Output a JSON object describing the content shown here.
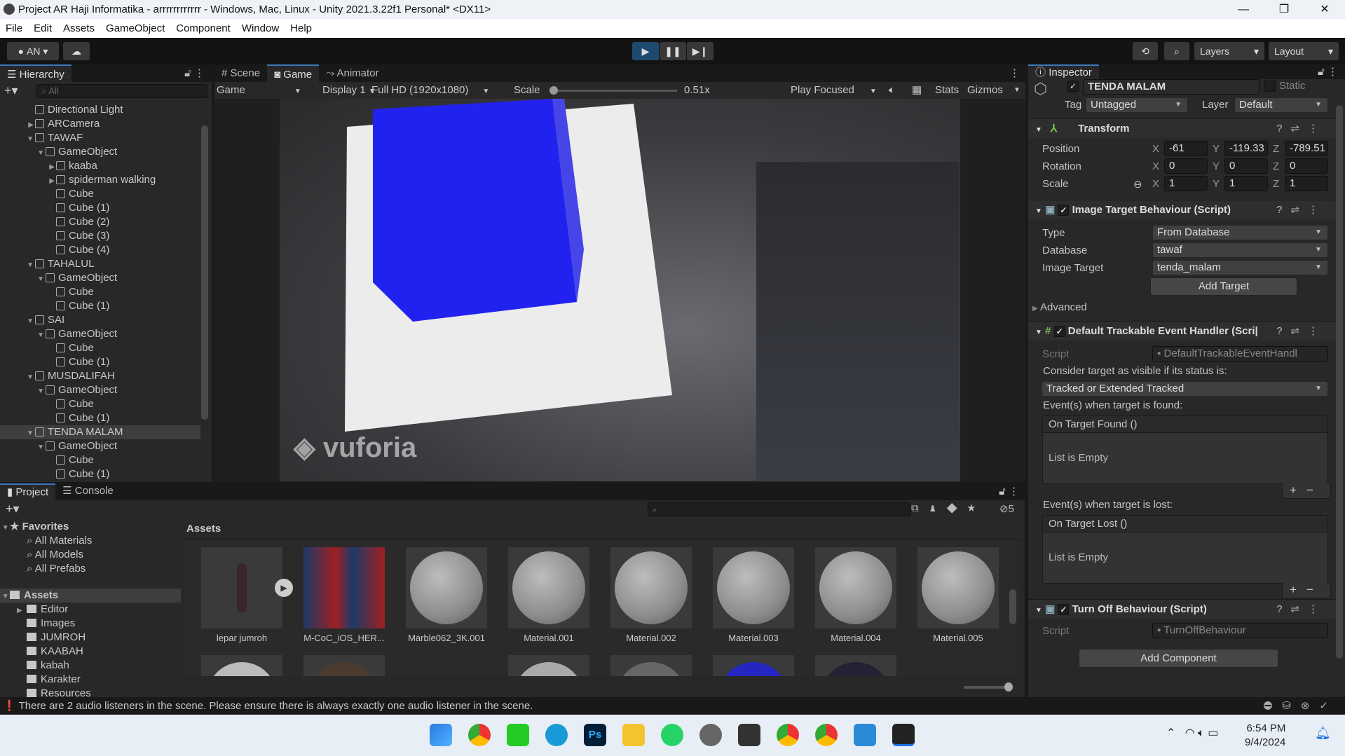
{
  "window": {
    "title": "Project AR Haji Informatika - arrrrrrrrrrrr - Windows, Mac, Linux - Unity 2021.3.22f1 Personal* <DX11>",
    "min": "—",
    "max": "❐",
    "close": "✕"
  },
  "menu": [
    "File",
    "Edit",
    "Assets",
    "GameObject",
    "Component",
    "Window",
    "Help"
  ],
  "toolbar": {
    "account": "AN",
    "layers": "Layers",
    "layout": "Layout"
  },
  "hierarchy": {
    "tab": "Hierarchy",
    "search_placeholder": "All",
    "items": [
      {
        "label": "Directional Light",
        "depth": 1,
        "arrow": ""
      },
      {
        "label": "ARCamera",
        "depth": 1,
        "arrow": "▶"
      },
      {
        "label": "TAWAF",
        "depth": 1,
        "arrow": "▼"
      },
      {
        "label": "GameObject",
        "depth": 2,
        "arrow": "▼"
      },
      {
        "label": "kaaba",
        "depth": 3,
        "arrow": "▶"
      },
      {
        "label": "spiderman walking",
        "depth": 3,
        "arrow": "▶"
      },
      {
        "label": "Cube",
        "depth": 3,
        "arrow": ""
      },
      {
        "label": "Cube (1)",
        "depth": 3,
        "arrow": ""
      },
      {
        "label": "Cube (2)",
        "depth": 3,
        "arrow": ""
      },
      {
        "label": "Cube (3)",
        "depth": 3,
        "arrow": ""
      },
      {
        "label": "Cube (4)",
        "depth": 3,
        "arrow": ""
      },
      {
        "label": "TAHALUL",
        "depth": 1,
        "arrow": "▼"
      },
      {
        "label": "GameObject",
        "depth": 2,
        "arrow": "▼"
      },
      {
        "label": "Cube",
        "depth": 3,
        "arrow": ""
      },
      {
        "label": "Cube (1)",
        "depth": 3,
        "arrow": ""
      },
      {
        "label": "SAI",
        "depth": 1,
        "arrow": "▼"
      },
      {
        "label": "GameObject",
        "depth": 2,
        "arrow": "▼"
      },
      {
        "label": "Cube",
        "depth": 3,
        "arrow": ""
      },
      {
        "label": "Cube (1)",
        "depth": 3,
        "arrow": ""
      },
      {
        "label": "MUSDALIFAH",
        "depth": 1,
        "arrow": "▼"
      },
      {
        "label": "GameObject",
        "depth": 2,
        "arrow": "▼"
      },
      {
        "label": "Cube",
        "depth": 3,
        "arrow": ""
      },
      {
        "label": "Cube (1)",
        "depth": 3,
        "arrow": ""
      },
      {
        "label": "TENDA MALAM",
        "depth": 1,
        "arrow": "▼",
        "selected": true
      },
      {
        "label": "GameObject",
        "depth": 2,
        "arrow": "▼"
      },
      {
        "label": "Cube",
        "depth": 3,
        "arrow": ""
      },
      {
        "label": "Cube (1)",
        "depth": 3,
        "arrow": ""
      }
    ]
  },
  "game": {
    "tabs": [
      "Scene",
      "Game",
      "Animator"
    ],
    "mode": "Game",
    "display": "Display 1",
    "resolution": "Full HD (1920x1080)",
    "scale_label": "Scale",
    "scale_value": "0.51x",
    "play_focused": "Play Focused",
    "stats": "Stats",
    "gizmos": "Gizmos",
    "watermark": "vuforia"
  },
  "inspector": {
    "tab": "Inspector",
    "object_name": "TENDA MALAM",
    "static": "Static",
    "tag_label": "Tag",
    "tag": "Untagged",
    "layer_label": "Layer",
    "layer": "Default",
    "transform": {
      "title": "Transform",
      "rows": [
        {
          "label": "Position",
          "x": "-61",
          "y": "-119.33",
          "z": "-789.51"
        },
        {
          "label": "Rotation",
          "x": "0",
          "y": "0",
          "z": "0"
        },
        {
          "label": "Scale",
          "x": "1",
          "y": "1",
          "z": "1"
        }
      ]
    },
    "image_target": {
      "title": "Image Target Behaviour (Script)",
      "type_label": "Type",
      "type": "From Database",
      "database_label": "Database",
      "database": "tawaf",
      "target_label": "Image Target",
      "target": "tenda_malam",
      "add_target": "Add Target",
      "advanced": "Advanced"
    },
    "event_handler": {
      "title": "Default Trackable Event Handler (Scri|",
      "script_label": "Script",
      "script": "DefaultTrackableEventHandl",
      "consider": "Consider target as visible if its status is:",
      "status": "Tracked or Extended Tracked",
      "found_label": "Event(s) when target is found:",
      "found_event": "On Target Found ()",
      "lost_label": "Event(s) when target is lost:",
      "lost_event": "On Target Lost ()",
      "empty": "List is Empty"
    },
    "turn_off": {
      "title": "Turn Off Behaviour (Script)",
      "script_label": "Script",
      "script": "TurnOffBehaviour"
    },
    "add_component": "Add Component"
  },
  "project": {
    "tabs": [
      "Project",
      "Console"
    ],
    "hidden_count": "5",
    "breadcrumb": "Assets",
    "favorites": {
      "label": "Favorites",
      "items": [
        "All Materials",
        "All Models",
        "All Prefabs"
      ]
    },
    "assets_root": "Assets",
    "folders": [
      "Editor",
      "Images",
      "JUMROH",
      "KAABAH",
      "kabah",
      "Karakter",
      "Resources"
    ],
    "assets": [
      "lepar jumroh",
      "M-CoC_iOS_HER...",
      "Marble062_3K.001",
      "Material.001",
      "Material.002",
      "Material.003",
      "Material.004",
      "Material.005"
    ]
  },
  "status": {
    "message": "There are 2 audio listeners in the scene. Please ensure there is always exactly one audio listener in the scene."
  },
  "taskbar": {
    "time": "6:54 PM",
    "date": "9/4/2024"
  }
}
